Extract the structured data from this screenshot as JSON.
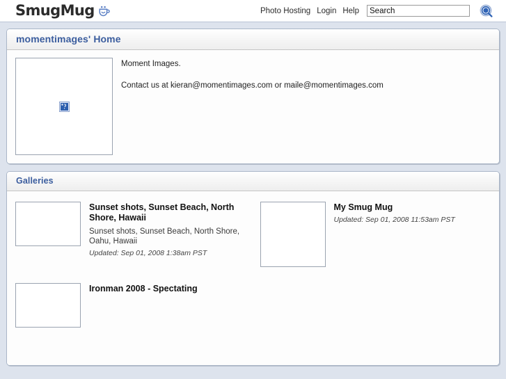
{
  "header": {
    "brand": "SmugMug",
    "brand_icon": "smugmug-mug-smile-icon",
    "nav": [
      {
        "label": "Photo Hosting",
        "name": "photo-hosting"
      },
      {
        "label": "Login",
        "name": "login"
      },
      {
        "label": "Help",
        "name": "help"
      }
    ],
    "search": {
      "value": "",
      "placeholder": "Search",
      "button_icon": "search-magnifier-icon"
    }
  },
  "home_panel": {
    "title": "momentimages' Home",
    "photo": {
      "alt": "broken-image-placeholder",
      "icon": "broken-image-icon"
    },
    "bio_lines": [
      "Moment Images.",
      "Contact us at kieran@momentimages.com or maile@momentimages.com"
    ]
  },
  "galleries_panel": {
    "title": "Galleries",
    "items": [
      {
        "title": "Sunset shots, Sunset Beach, North Shore, Hawaii",
        "description": "Sunset shots, Sunset Beach, North Shore, Oahu, Hawaii",
        "updated": "Updated: Sep 01, 2008 1:38am PST",
        "thumb_shape": "landscape"
      },
      {
        "title": "My Smug Mug",
        "description": "",
        "updated": "Updated: Sep 01, 2008 11:53am PST",
        "thumb_shape": "square"
      },
      {
        "title": "Ironman 2008 - Spectating",
        "description": "",
        "updated": "",
        "thumb_shape": "landscape"
      }
    ]
  },
  "colors": {
    "page_background": "#dde3ed",
    "panel_background": "#fdfdfd",
    "panel_border": "#aab6c8",
    "heading_blue": "#3b5d9e",
    "logo_accent": "#5a7fc4"
  }
}
